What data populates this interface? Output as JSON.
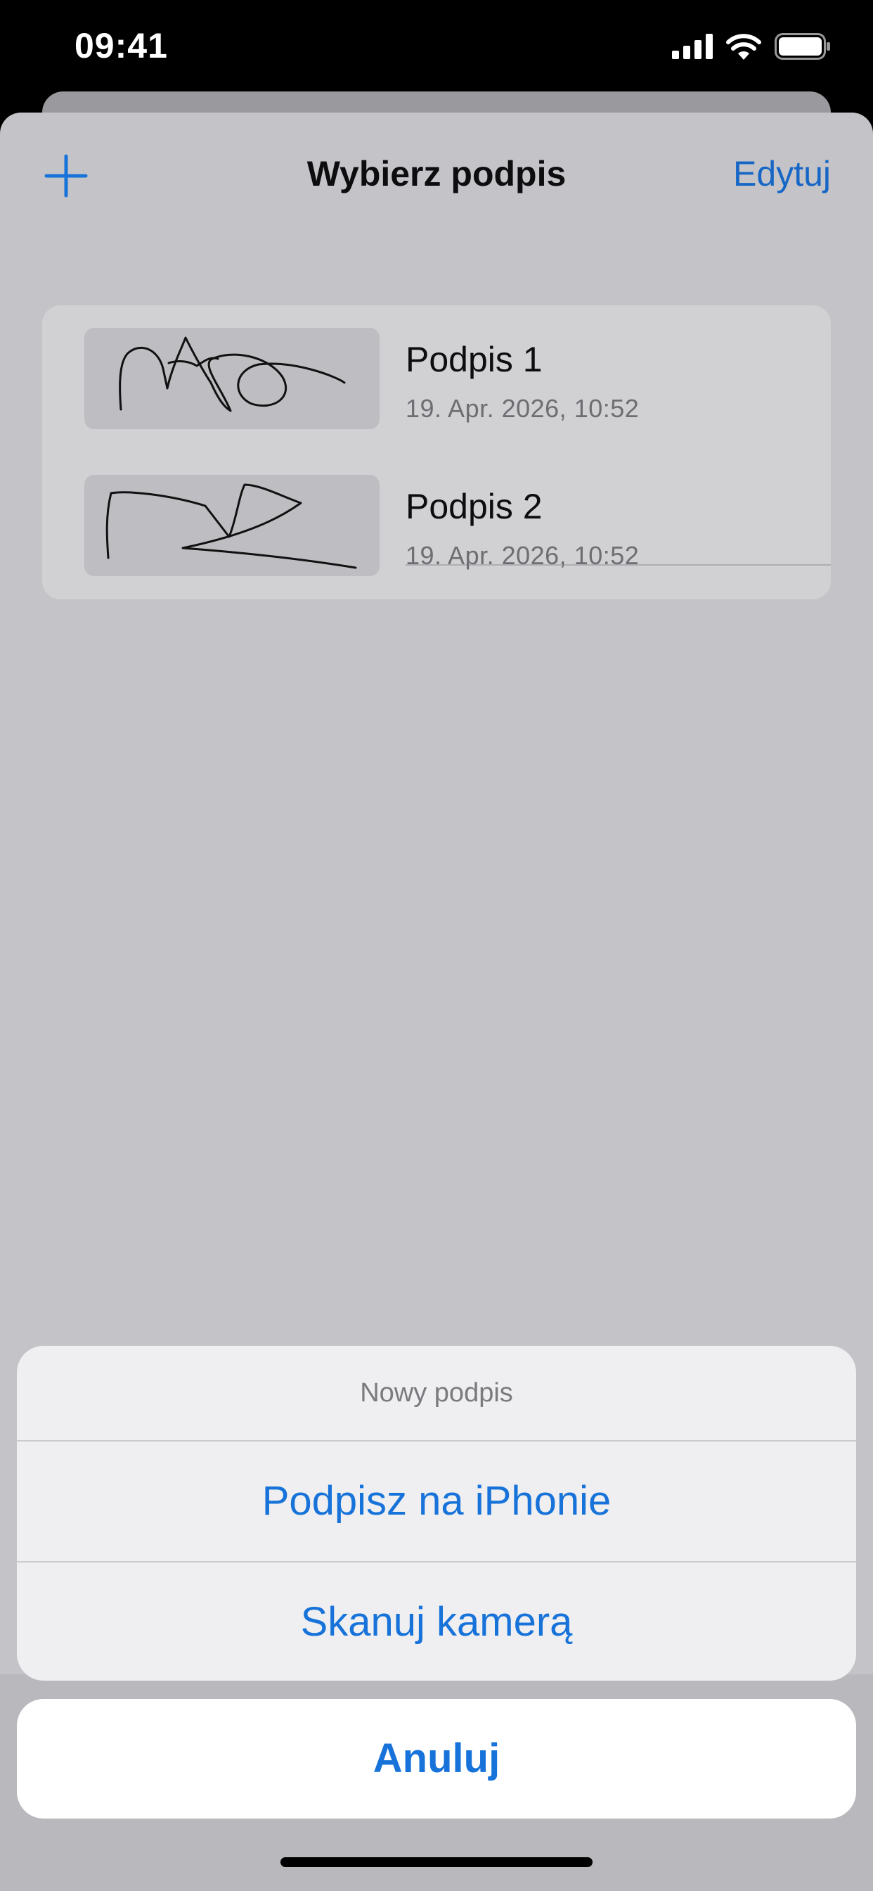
{
  "status_bar": {
    "time": "09:41",
    "icons": [
      "cellular-signal-icon",
      "wifi-icon",
      "battery-icon"
    ]
  },
  "nav": {
    "add_icon": "plus-icon",
    "title": "Wybierz podpis",
    "edit_label": "Edytuj"
  },
  "signatures": [
    {
      "name": "Podpis 1",
      "date": "19. Apr. 2026, 10:52"
    },
    {
      "name": "Podpis 2",
      "date": "19. Apr. 2026, 10:52"
    }
  ],
  "action_sheet": {
    "title": "Nowy podpis",
    "options": [
      "Podpisz na iPhonie",
      "Skanuj kamerą"
    ],
    "cancel_label": "Anuluj"
  },
  "colors": {
    "accent": "#1773D9",
    "sheet_background": "#C4C4C8"
  }
}
